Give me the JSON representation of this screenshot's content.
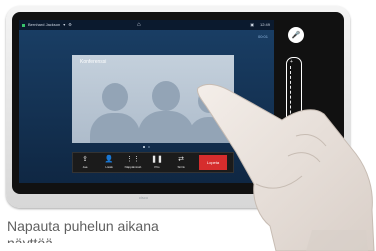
{
  "status_bar": {
    "caller": "Bernhard Jackson",
    "call_time": "12:49",
    "duration": "00:01"
  },
  "conference": {
    "title": "Konferenssi"
  },
  "toolbar": {
    "items": [
      {
        "label": "Jaa",
        "icon": "share-icon"
      },
      {
        "label": "Lisää",
        "icon": "add-user-icon"
      },
      {
        "label": "Näppäimistö",
        "icon": "keypad-icon"
      },
      {
        "label": "Pito",
        "icon": "pause-icon"
      },
      {
        "label": "Siirrä",
        "icon": "transfer-icon"
      }
    ],
    "end_label": "Lopeta"
  },
  "brand": {
    "logo": "cisco"
  },
  "caption": {
    "line1": "Napauta puhelun aikana",
    "line2": "näyttöä"
  },
  "colors": {
    "end_call": "#d62d2d",
    "screen_bg": "#1a3f66"
  }
}
